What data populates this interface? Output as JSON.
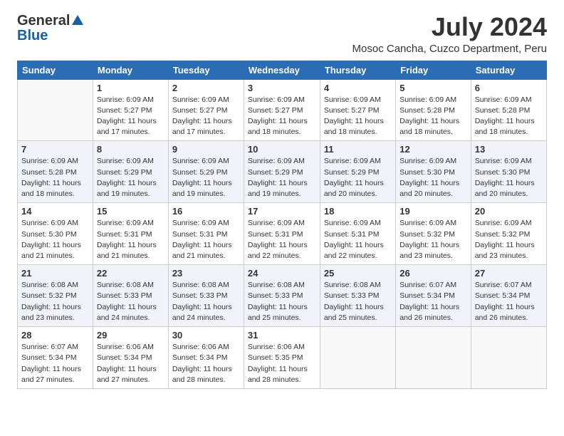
{
  "logo": {
    "general": "General",
    "blue": "Blue"
  },
  "title": "July 2024",
  "location": "Mosoc Cancha, Cuzco Department, Peru",
  "headers": [
    "Sunday",
    "Monday",
    "Tuesday",
    "Wednesday",
    "Thursday",
    "Friday",
    "Saturday"
  ],
  "weeks": [
    [
      {
        "day": "",
        "sunrise": "",
        "sunset": "",
        "daylight": ""
      },
      {
        "day": "1",
        "sunrise": "Sunrise: 6:09 AM",
        "sunset": "Sunset: 5:27 PM",
        "daylight": "Daylight: 11 hours and 17 minutes."
      },
      {
        "day": "2",
        "sunrise": "Sunrise: 6:09 AM",
        "sunset": "Sunset: 5:27 PM",
        "daylight": "Daylight: 11 hours and 17 minutes."
      },
      {
        "day": "3",
        "sunrise": "Sunrise: 6:09 AM",
        "sunset": "Sunset: 5:27 PM",
        "daylight": "Daylight: 11 hours and 18 minutes."
      },
      {
        "day": "4",
        "sunrise": "Sunrise: 6:09 AM",
        "sunset": "Sunset: 5:27 PM",
        "daylight": "Daylight: 11 hours and 18 minutes."
      },
      {
        "day": "5",
        "sunrise": "Sunrise: 6:09 AM",
        "sunset": "Sunset: 5:28 PM",
        "daylight": "Daylight: 11 hours and 18 minutes."
      },
      {
        "day": "6",
        "sunrise": "Sunrise: 6:09 AM",
        "sunset": "Sunset: 5:28 PM",
        "daylight": "Daylight: 11 hours and 18 minutes."
      }
    ],
    [
      {
        "day": "7",
        "sunrise": "Sunrise: 6:09 AM",
        "sunset": "Sunset: 5:28 PM",
        "daylight": "Daylight: 11 hours and 18 minutes."
      },
      {
        "day": "8",
        "sunrise": "Sunrise: 6:09 AM",
        "sunset": "Sunset: 5:29 PM",
        "daylight": "Daylight: 11 hours and 19 minutes."
      },
      {
        "day": "9",
        "sunrise": "Sunrise: 6:09 AM",
        "sunset": "Sunset: 5:29 PM",
        "daylight": "Daylight: 11 hours and 19 minutes."
      },
      {
        "day": "10",
        "sunrise": "Sunrise: 6:09 AM",
        "sunset": "Sunset: 5:29 PM",
        "daylight": "Daylight: 11 hours and 19 minutes."
      },
      {
        "day": "11",
        "sunrise": "Sunrise: 6:09 AM",
        "sunset": "Sunset: 5:29 PM",
        "daylight": "Daylight: 11 hours and 20 minutes."
      },
      {
        "day": "12",
        "sunrise": "Sunrise: 6:09 AM",
        "sunset": "Sunset: 5:30 PM",
        "daylight": "Daylight: 11 hours and 20 minutes."
      },
      {
        "day": "13",
        "sunrise": "Sunrise: 6:09 AM",
        "sunset": "Sunset: 5:30 PM",
        "daylight": "Daylight: 11 hours and 20 minutes."
      }
    ],
    [
      {
        "day": "14",
        "sunrise": "Sunrise: 6:09 AM",
        "sunset": "Sunset: 5:30 PM",
        "daylight": "Daylight: 11 hours and 21 minutes."
      },
      {
        "day": "15",
        "sunrise": "Sunrise: 6:09 AM",
        "sunset": "Sunset: 5:31 PM",
        "daylight": "Daylight: 11 hours and 21 minutes."
      },
      {
        "day": "16",
        "sunrise": "Sunrise: 6:09 AM",
        "sunset": "Sunset: 5:31 PM",
        "daylight": "Daylight: 11 hours and 21 minutes."
      },
      {
        "day": "17",
        "sunrise": "Sunrise: 6:09 AM",
        "sunset": "Sunset: 5:31 PM",
        "daylight": "Daylight: 11 hours and 22 minutes."
      },
      {
        "day": "18",
        "sunrise": "Sunrise: 6:09 AM",
        "sunset": "Sunset: 5:31 PM",
        "daylight": "Daylight: 11 hours and 22 minutes."
      },
      {
        "day": "19",
        "sunrise": "Sunrise: 6:09 AM",
        "sunset": "Sunset: 5:32 PM",
        "daylight": "Daylight: 11 hours and 23 minutes."
      },
      {
        "day": "20",
        "sunrise": "Sunrise: 6:09 AM",
        "sunset": "Sunset: 5:32 PM",
        "daylight": "Daylight: 11 hours and 23 minutes."
      }
    ],
    [
      {
        "day": "21",
        "sunrise": "Sunrise: 6:08 AM",
        "sunset": "Sunset: 5:32 PM",
        "daylight": "Daylight: 11 hours and 23 minutes."
      },
      {
        "day": "22",
        "sunrise": "Sunrise: 6:08 AM",
        "sunset": "Sunset: 5:33 PM",
        "daylight": "Daylight: 11 hours and 24 minutes."
      },
      {
        "day": "23",
        "sunrise": "Sunrise: 6:08 AM",
        "sunset": "Sunset: 5:33 PM",
        "daylight": "Daylight: 11 hours and 24 minutes."
      },
      {
        "day": "24",
        "sunrise": "Sunrise: 6:08 AM",
        "sunset": "Sunset: 5:33 PM",
        "daylight": "Daylight: 11 hours and 25 minutes."
      },
      {
        "day": "25",
        "sunrise": "Sunrise: 6:08 AM",
        "sunset": "Sunset: 5:33 PM",
        "daylight": "Daylight: 11 hours and 25 minutes."
      },
      {
        "day": "26",
        "sunrise": "Sunrise: 6:07 AM",
        "sunset": "Sunset: 5:34 PM",
        "daylight": "Daylight: 11 hours and 26 minutes."
      },
      {
        "day": "27",
        "sunrise": "Sunrise: 6:07 AM",
        "sunset": "Sunset: 5:34 PM",
        "daylight": "Daylight: 11 hours and 26 minutes."
      }
    ],
    [
      {
        "day": "28",
        "sunrise": "Sunrise: 6:07 AM",
        "sunset": "Sunset: 5:34 PM",
        "daylight": "Daylight: 11 hours and 27 minutes."
      },
      {
        "day": "29",
        "sunrise": "Sunrise: 6:06 AM",
        "sunset": "Sunset: 5:34 PM",
        "daylight": "Daylight: 11 hours and 27 minutes."
      },
      {
        "day": "30",
        "sunrise": "Sunrise: 6:06 AM",
        "sunset": "Sunset: 5:34 PM",
        "daylight": "Daylight: 11 hours and 28 minutes."
      },
      {
        "day": "31",
        "sunrise": "Sunrise: 6:06 AM",
        "sunset": "Sunset: 5:35 PM",
        "daylight": "Daylight: 11 hours and 28 minutes."
      },
      {
        "day": "",
        "sunrise": "",
        "sunset": "",
        "daylight": ""
      },
      {
        "day": "",
        "sunrise": "",
        "sunset": "",
        "daylight": ""
      },
      {
        "day": "",
        "sunrise": "",
        "sunset": "",
        "daylight": ""
      }
    ]
  ]
}
